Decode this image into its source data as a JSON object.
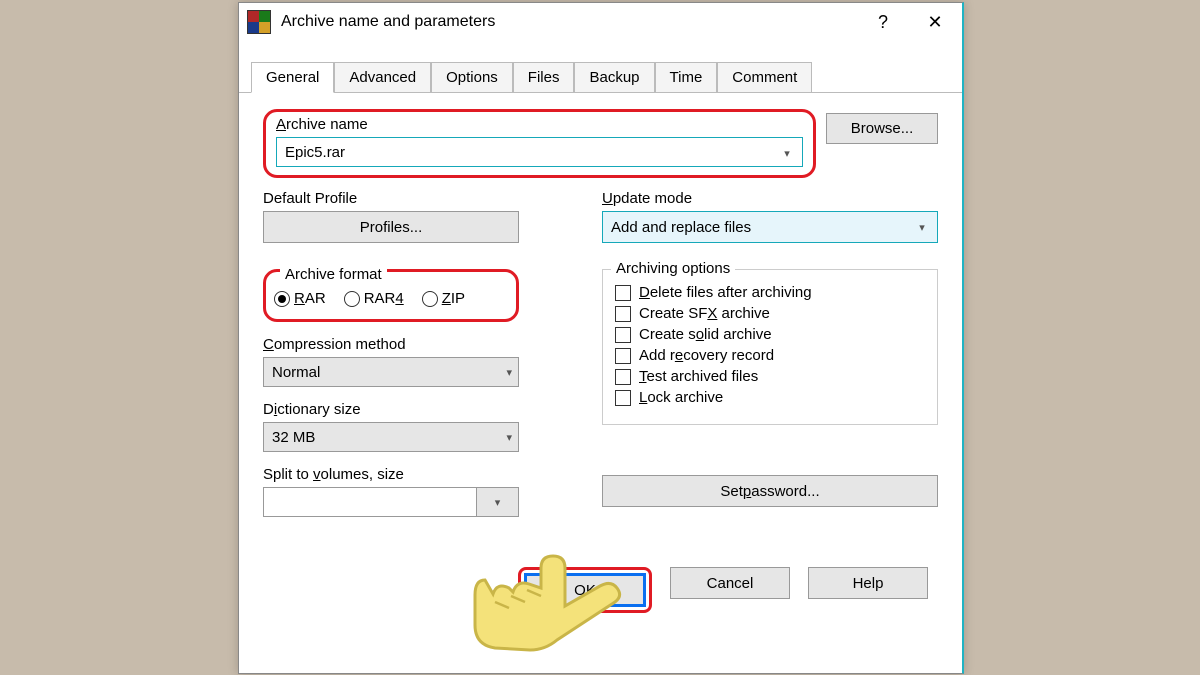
{
  "window": {
    "title": "Archive name and parameters",
    "help": "?",
    "close": "✕"
  },
  "tabs": [
    "General",
    "Advanced",
    "Options",
    "Files",
    "Backup",
    "Time",
    "Comment"
  ],
  "archive_name": {
    "label_a": "A",
    "label_rest": "rchive name",
    "value": "Epic5.rar"
  },
  "browse_btn": "Browse...",
  "default_profile_label": "Default Profile",
  "profiles_btn": "Profiles...",
  "update_mode": {
    "label_u": "U",
    "label_rest": "pdate mode",
    "value": "Add and replace files"
  },
  "archive_format": {
    "legend": "Archive format",
    "options": [
      {
        "u": "R",
        "rest": "AR",
        "selected": true
      },
      {
        "u": "",
        "rest": "RAR",
        "u2": "4",
        "selected": false
      },
      {
        "u": "Z",
        "rest": "IP",
        "selected": false
      }
    ]
  },
  "archiving_options": {
    "legend": "Archiving options",
    "items": [
      {
        "pre": "",
        "u": "D",
        "post": "elete files after archiving"
      },
      {
        "pre": "Create SF",
        "u": "X",
        "post": " archive"
      },
      {
        "pre": "Create s",
        "u": "o",
        "post": "lid archive"
      },
      {
        "pre": "Add r",
        "u": "e",
        "post": "covery record"
      },
      {
        "pre": "",
        "u": "T",
        "post": "est archived files"
      },
      {
        "pre": "",
        "u": "L",
        "post": "ock archive"
      }
    ]
  },
  "compression": {
    "label_c": "C",
    "label_rest": "ompression method",
    "value": "Normal"
  },
  "dictionary": {
    "label_pre": "D",
    "label_u": "i",
    "label_rest": "ctionary size",
    "value": "32 MB"
  },
  "split": {
    "label_pre": "Split to ",
    "label_u": "v",
    "label_rest": "olumes, size",
    "value": ""
  },
  "password_btn_pre": "Set ",
  "password_btn_u": "p",
  "password_btn_post": "assword...",
  "footer": {
    "ok": "OK",
    "cancel": "Cancel",
    "help": "Help"
  }
}
